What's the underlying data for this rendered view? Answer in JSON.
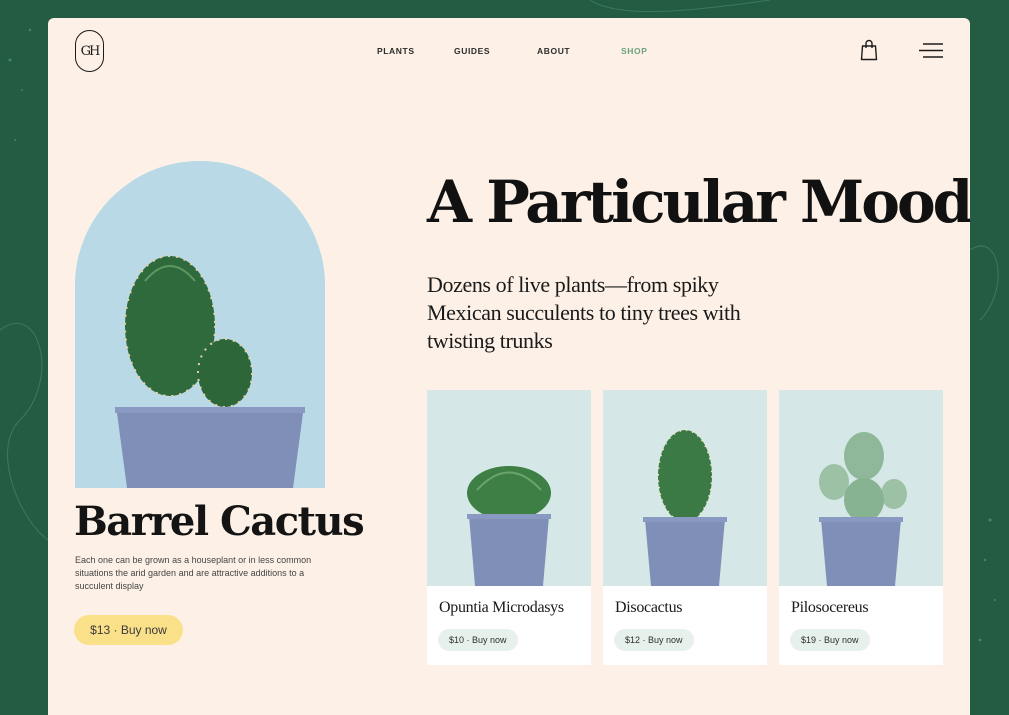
{
  "brand": {
    "logo_text": "GH"
  },
  "nav": {
    "items": [
      {
        "label": "PLANTS",
        "active": false
      },
      {
        "label": "GUIDES",
        "active": false
      },
      {
        "label": "ABOUT",
        "active": false
      },
      {
        "label": "SHOP",
        "active": true
      }
    ]
  },
  "header_icons": [
    "shopping-bag-icon",
    "hamburger-menu-icon"
  ],
  "featured": {
    "name": "Barrel Cactus",
    "description": "Each one can be grown as a houseplant or in less common situations the arid garden and are attractive additions to a succulent display",
    "buy_label": "$13 · Buy now"
  },
  "headline": "A Particular Mood",
  "subheadline": "Dozens of live plants—from spiky Mexican succulents to tiny trees with twisting trunks",
  "products": [
    {
      "name": "Opuntia Microdasys",
      "buy_label": "$10 · Buy now"
    },
    {
      "name": "Disocactus",
      "buy_label": "$12 · Buy now"
    },
    {
      "name": "Pilosocereus",
      "buy_label": "$19 · Buy now"
    }
  ],
  "colors": {
    "background_green": "#245c43",
    "card_cream": "#fdf1e7",
    "buy_yellow": "#fbe08a",
    "active_nav": "#6ba37f",
    "pot_blue": "#7f8fb8",
    "product_buy_bg": "#e6f1ec"
  }
}
